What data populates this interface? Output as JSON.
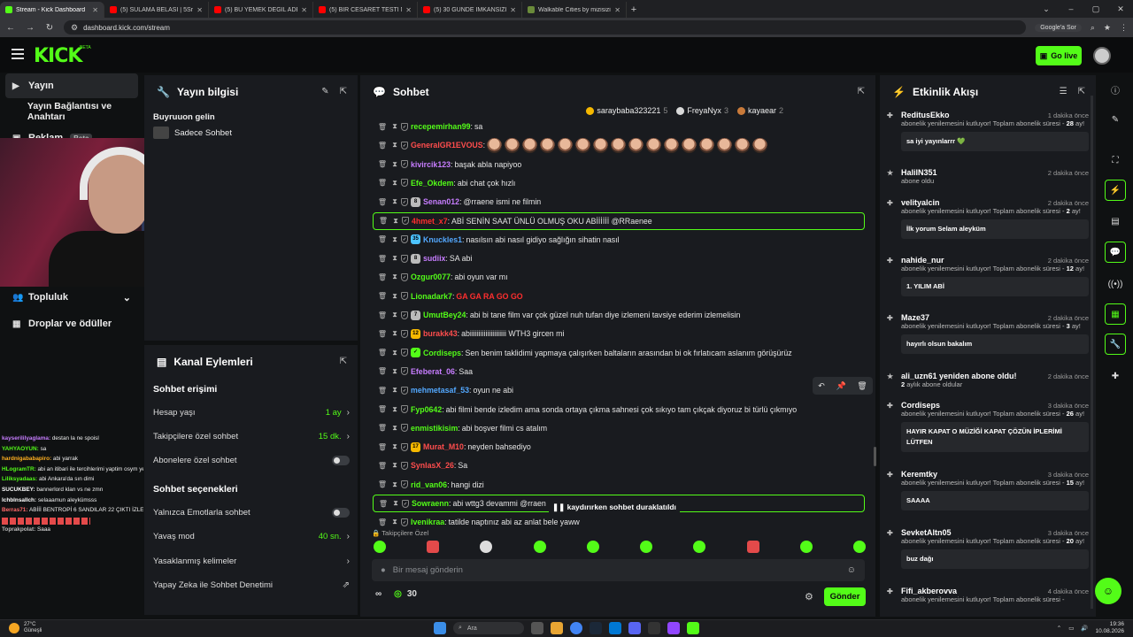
{
  "browser": {
    "tabs": [
      {
        "title": "Stream - Kick Dashboard",
        "color": "#53fc18",
        "active": true
      },
      {
        "title": "(5) SULAMA BELASI | 5Sriders |",
        "color": "#ff0000"
      },
      {
        "title": "(5) BU YEMEK DEĞİL ADETA ŞÖ",
        "color": "#ff0000"
      },
      {
        "title": "(5) BİR CESARET TESTİ NASIL FE",
        "color": "#ff0000"
      },
      {
        "title": "(5) 30 GÜNDE İMKANSIZI BAŞA",
        "color": "#ff0000"
      },
      {
        "title": "Walkable Cities by mizisiziz",
        "color": "#6a8a3a"
      }
    ],
    "new_tab": "+",
    "url": "dashboard.kick.com/stream",
    "google_sor": "Google'a Sor",
    "win_controls": [
      "⌄",
      "–",
      "▢",
      "✕"
    ]
  },
  "header": {
    "logo": "KICK",
    "beta": "BETA",
    "go_live": "Go live"
  },
  "leftnav": {
    "items": [
      {
        "label": "Yayın",
        "icon": "▶"
      },
      {
        "label": "Yayın Bağlantısı ve Anahtarı",
        "icon": ""
      },
      {
        "label": "Reklam",
        "icon": "▣",
        "badge": "Beta"
      },
      {
        "label": "Topluluk",
        "icon": "👥",
        "chev": "⌄"
      },
      {
        "label": "Droplar ve ödüller",
        "icon": "▦"
      }
    ]
  },
  "overlay_chat": [
    {
      "user": "kayserililyaglama:",
      "text": "destan la ne spoisl",
      "color": "#c77dff"
    },
    {
      "user": "YAHYAOYUN:",
      "text": "sa",
      "color": "#53fc18"
    },
    {
      "user": "hardnigababapiro:",
      "text": "abi yarrak",
      "color": "#ffb020"
    },
    {
      "user": "HLogramTR:",
      "text": "abi an itibari ile tercihlerimi yaptim osym ye gonderdim bi hayirli olsununu alirim",
      "color": "#53fc18"
    },
    {
      "user": "Liliksyadaas:",
      "text": "abi Ankara'da sın dimi",
      "color": "#53fc18"
    },
    {
      "user": "SUCUKBEY:",
      "text": "bannerlord klan vs ne zmn",
      "color": "#ffffff"
    },
    {
      "user": "lchblnsallch:",
      "text": "selaaamun aleykümsss",
      "color": "#ffffff"
    },
    {
      "user": "Berras71:",
      "text": "ABİİİ BENTROPİ 6 SANDILAR 22 ÇIKTI İZLEEE",
      "color": "#ff6a6a"
    },
    {
      "user": "",
      "text": "",
      "color": "#ff4d4d"
    },
    {
      "user": "Toprakpolat:",
      "text": "Saaa",
      "color": "#bbbbbb"
    }
  ],
  "yayin_panel": {
    "title": "Yayın bilgisi",
    "greeting": "Buyruuon gelin",
    "mode": "Sadece Sohbet"
  },
  "kanal_panel": {
    "title": "Kanal Eylemleri",
    "section1": "Sohbet erişimi",
    "rows1": [
      {
        "label": "Hesap yaşı",
        "value": "1 ay"
      },
      {
        "label": "Takipçilere özel sohbet",
        "value": "15 dk."
      },
      {
        "label": "Abonelere özel sohbet",
        "value": ""
      }
    ],
    "section2": "Sohbet seçenekleri",
    "rows2": [
      {
        "label": "Yalnızca Emotlarla sohbet",
        "value": ""
      },
      {
        "label": "Yavaş mod",
        "value": "40 sn."
      },
      {
        "label": "Yasaklanmış kelimeler",
        "value": ""
      },
      {
        "label": "Yapay Zeka ile Sohbet Denetimi",
        "value": ""
      }
    ]
  },
  "chat": {
    "title": "Sohbet",
    "top_gifters": [
      {
        "name": "saraybaba323221",
        "count": "5",
        "color": "#f5b800"
      },
      {
        "name": "FreyaNyx",
        "count": "3",
        "color": "#d9d9d9"
      },
      {
        "name": "kayaear",
        "count": "2",
        "color": "#c97a3a"
      }
    ],
    "messages": [
      {
        "user": "recepemirhan99",
        "color": "#53fc18",
        "text": "sa"
      },
      {
        "user": "GeneralGR1EVOUS",
        "color": "#ff4d4d",
        "text": "",
        "emotes": 16
      },
      {
        "user": "kivircik123",
        "color": "#c77dff",
        "text": "başak abla napiyoo"
      },
      {
        "user": "Efe_Okdem",
        "color": "#53fc18",
        "text": "abi chat çok hızlı"
      },
      {
        "user": "Senan012",
        "color": "#c77dff",
        "text": "@rraene ismi ne filmin",
        "badge": "8"
      },
      {
        "user": "4hmet_x7",
        "color": "#ff2e2e",
        "text": "ABİ SENİN SAAT ÜNLÜ OLMUŞ OKU ABİİİİİİ @RRaenee",
        "hl": true
      },
      {
        "user": "Knuckles1",
        "color": "#53a8ff",
        "text": "nasılsın abi nasıl gidiyo sağlığın sihatin nasıl",
        "badge": "35"
      },
      {
        "user": "sudiix",
        "color": "#c77dff",
        "text": "SA abi",
        "badge": "8"
      },
      {
        "user": "Ozgur0077",
        "color": "#53fc18",
        "text": "abi oyun var mı"
      },
      {
        "user": "Lionadark7",
        "color": "#53fc18",
        "text": "GA GA RA GO GO",
        "red": true
      },
      {
        "user": "UmutBey24",
        "color": "#53fc18",
        "text": "abi bi tane film var çok güzel nuh tufan diye izlemeni tavsiye ederim izlemelisin",
        "badge": "7"
      },
      {
        "user": "burakk43",
        "color": "#ff4d4d",
        "text": "abiiiiiiiiiiiiiiiiiiiii WTH3 gircen mi",
        "badge": "12"
      },
      {
        "user": "Cordiseps",
        "color": "#53fc18",
        "text": "Sen benim taklidimi yapmaya çalışırken baltaların arasından bi ok fırlatıcam aslanım görüşürüz",
        "badge": "✓"
      },
      {
        "user": "Efeberat_06",
        "color": "#c77dff",
        "text": "Saa"
      },
      {
        "user": "mehmetasaf_53",
        "color": "#53a8ff",
        "text": "oyun ne abi"
      },
      {
        "user": "Fyp0642",
        "color": "#53fc18",
        "text": "abi filmi bende izledim ama sonda ortaya çıkma sahnesi çok sıkıyo tam çıkçak diyoruz bi türlü çıkmıyo"
      },
      {
        "user": "enmistikisim",
        "color": "#53fc18",
        "text": "abi boşver filmi cs atalım"
      },
      {
        "user": "Murat_M10",
        "color": "#ff4d4d",
        "text": "neyden bahsediyo",
        "badge": "17"
      },
      {
        "user": "SynlasX_26",
        "color": "#ff4d4d",
        "text": "Sa"
      },
      {
        "user": "rid_van06",
        "color": "#53fc18",
        "text": "hangi dizi"
      },
      {
        "user": "Sowraenn",
        "color": "#53fc18",
        "text": "abi wttg3 devammi @rraen",
        "hl": true
      },
      {
        "user": "Ivenikraa",
        "color": "#53fc18",
        "text": "tatilde naptınız abi az anlat bele yaww"
      }
    ],
    "paused": "❚❚ kaydırırken sohbet duraklatıldı",
    "followers_only": "🔒 Takipçilere Özel",
    "input_placeholder": "Bir mesaj gönderin",
    "viewer_icon": "∞",
    "points": "30",
    "send": "Gönder"
  },
  "activity": {
    "title": "Etkinlik Akışı",
    "events": [
      {
        "name": "ReditusEkko",
        "time": "1 dakika önce",
        "desc": "abonelik yenilemesini kutluyor! Toplam abonelik süresi - ",
        "bold": "28",
        "after": " ay!",
        "msg": "sa iyi yayınlarrr 💚",
        "icon": "✚"
      },
      {
        "name": "HalilN351",
        "time": "2 dakika önce",
        "desc": "abone oldu",
        "bold": "",
        "after": "",
        "msg": "",
        "icon": "★"
      },
      {
        "name": "velityalcin",
        "time": "2 dakika önce",
        "desc": "abonelik yenilemesini kutluyor! Toplam abonelik süresi - ",
        "bold": "2",
        "after": " ay!",
        "msg": "İlk yorum Selam aleyküm",
        "icon": "✚"
      },
      {
        "name": "nahide_nur",
        "time": "2 dakika önce",
        "desc": "abonelik yenilemesini kutluyor! Toplam abonelik süresi - ",
        "bold": "12",
        "after": " ay!",
        "msg": "1. YILIM ABİ",
        "icon": "✚"
      },
      {
        "name": "Maze37",
        "time": "2 dakika önce",
        "desc": "abonelik yenilemesini kutluyor! Toplam abonelik süresi - ",
        "bold": "3",
        "after": " ay!",
        "msg": "hayırlı olsun bakalım",
        "icon": "✚"
      },
      {
        "name": "ali_uzn61 yeniden abone oldu!",
        "time": "2 dakika önce",
        "desc": "",
        "bold": "2",
        "after": " aylık abone oldular",
        "msg": "",
        "icon": "★"
      },
      {
        "name": "Cordiseps",
        "time": "3 dakika önce",
        "desc": "abonelik yenilemesini kutluyor! Toplam abonelik süresi - ",
        "bold": "26",
        "after": " ay!",
        "msg": "HAYIR KAPAT O MÜZİĞİ KAPAT ÇÖZÜN İPLERİMİ LÜTFEN",
        "icon": "✚"
      },
      {
        "name": "Keremtky",
        "time": "3 dakika önce",
        "desc": "abonelik yenilemesini kutluyor! Toplam abonelik süresi - ",
        "bold": "15",
        "after": " ay!",
        "msg": "SAAAA",
        "icon": "✚"
      },
      {
        "name": "SevketAltn05",
        "time": "3 dakika önce",
        "desc": "abonelik yenilemesini kutluyor! Toplam abonelik süresi - ",
        "bold": "20",
        "after": " ay!",
        "msg": "buz dağı",
        "icon": "✚"
      },
      {
        "name": "Fifi_akberovva",
        "time": "4 dakika önce",
        "desc": "abonelik yenilemesini kutluyor! Toplam abonelik süresi - ",
        "bold": "",
        "after": "",
        "msg": "",
        "icon": "✚"
      }
    ]
  },
  "taskbar": {
    "temp": "27°C",
    "weather": "Güneşli",
    "search": "Ara",
    "time": "19:36",
    "date": "10.08.2026"
  }
}
